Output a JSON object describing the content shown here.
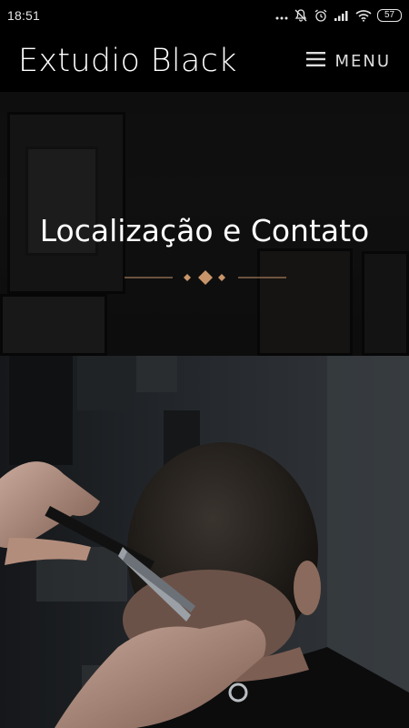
{
  "status_bar": {
    "time": "18:51",
    "battery": "57",
    "icons": [
      "dots-icon",
      "mute-icon",
      "alarm-icon",
      "signal-icon",
      "wifi-icon",
      "battery-icon"
    ]
  },
  "header": {
    "title": "Extudio Black",
    "menu_label": "MENU",
    "menu_icon": "hamburger-icon"
  },
  "hero": {
    "title": "Localização e Contato",
    "divider_icon": "diamond-ornament-icon",
    "accent_color": "#c8956a"
  },
  "photo": {
    "subject": "barber-cutting-hair-photo"
  },
  "colors": {
    "background": "#000000",
    "text": "#ffffff",
    "accent": "#c8956a"
  }
}
